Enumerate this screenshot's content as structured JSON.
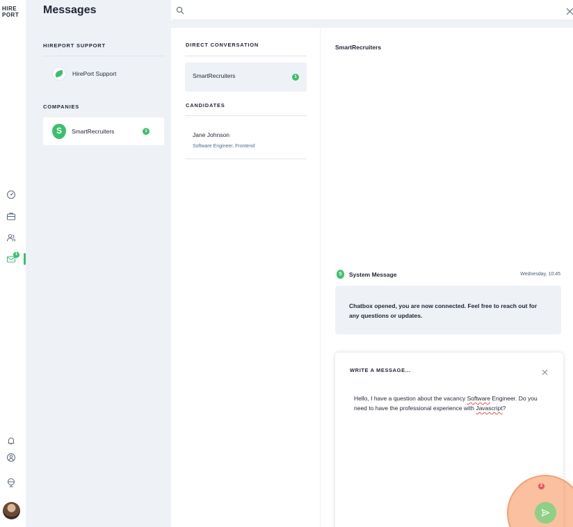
{
  "app": {
    "logo_line1": "HIRE",
    "logo_line2": "PORT",
    "page_title": "Messages"
  },
  "nav_rail": {
    "items": [
      {
        "icon": "dashboard-icon"
      },
      {
        "icon": "briefcase-icon"
      },
      {
        "icon": "candidates-icon"
      },
      {
        "icon": "mail-icon",
        "badge": "1",
        "active": true
      }
    ],
    "bottom_items": [
      {
        "icon": "bell-icon"
      },
      {
        "icon": "users-icon"
      },
      {
        "icon": "globe-icon"
      }
    ]
  },
  "companies_panel": {
    "support_section": "HIREPORT SUPPORT",
    "support_item": "HirePort Support",
    "companies_section": "COMPANIES",
    "companies": [
      {
        "name": "SmartRecruiters",
        "logo_letter": "S",
        "badge": "1"
      }
    ]
  },
  "search": {
    "placeholder": "",
    "value": ""
  },
  "conversations_panel": {
    "direct_section": "DIRECT CONVERSATION",
    "direct_item": {
      "name": "SmartRecruiters",
      "badge": "1"
    },
    "candidates_section": "CANDIDATES",
    "candidates": [
      {
        "name": "Jane Johnson",
        "role": "Software Engineer, Frontend"
      }
    ]
  },
  "chat": {
    "title": "SmartRecruiters",
    "system_message": {
      "icon_letter": "S",
      "sender": "System Message",
      "time": "Wednesday, 10:45",
      "text": "Chatbox opened, you are now connected. Feel free to reach out for any questions or updates."
    },
    "composer": {
      "label": "WRITE A MESSAGE...",
      "text_part1": "Hello, I have a question about the vacancy ",
      "spell1": "Software",
      "text_part2": " Engineer. Do you need to have the professional experience with ",
      "spell2": "Javascript",
      "text_part3": "?",
      "send_indicator": "2"
    }
  },
  "colors": {
    "accent_green": "#3cbf6d",
    "panel_bg": "#eef2f7",
    "highlight_orange": "#f58c50"
  }
}
